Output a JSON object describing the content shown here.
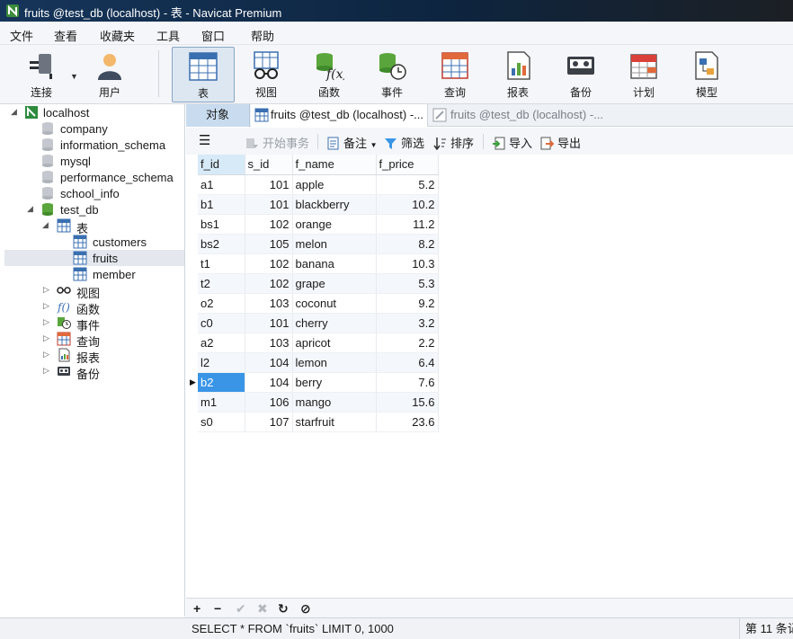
{
  "window": {
    "title": "fruits @test_db (localhost) - 表 - Navicat Premium"
  },
  "menu": [
    "文件",
    "查看",
    "收藏夹",
    "工具",
    "窗口",
    "帮助"
  ],
  "toolbar": [
    {
      "label": "连接",
      "icon": "plug-icon"
    },
    {
      "label": "用户",
      "icon": "user-icon"
    },
    {
      "label": "表",
      "icon": "table-icon"
    },
    {
      "label": "视图",
      "icon": "view-glasses-icon"
    },
    {
      "label": "函数",
      "icon": "function-icon"
    },
    {
      "label": "事件",
      "icon": "event-clock-icon"
    },
    {
      "label": "查询",
      "icon": "query-icon"
    },
    {
      "label": "报表",
      "icon": "report-icon"
    },
    {
      "label": "备份",
      "icon": "backup-tape-icon"
    },
    {
      "label": "计划",
      "icon": "calendar-icon"
    },
    {
      "label": "模型",
      "icon": "model-icon"
    }
  ],
  "tree": {
    "connection": "localhost",
    "databases": [
      "company",
      "information_schema",
      "mysql",
      "performance_schema",
      "school_info",
      "test_db"
    ],
    "tables_folder": "表",
    "tables": [
      "customers",
      "fruits",
      "member"
    ],
    "other_folders": [
      "视图",
      "函数",
      "事件",
      "查询",
      "报表",
      "备份"
    ]
  },
  "tabs": {
    "objects": "对象",
    "tab1": "fruits @test_db (localhost) -...",
    "tab2": "fruits @test_db (localhost) -..."
  },
  "gridtools": {
    "begin_tx": "开始事务",
    "memo": "备注",
    "filter": "筛选",
    "sort": "排序",
    "import": "导入",
    "export": "导出"
  },
  "grid": {
    "columns": [
      "f_id",
      "s_id",
      "f_name",
      "f_price"
    ],
    "rows": [
      [
        "a1",
        "101",
        "apple",
        "5.2"
      ],
      [
        "b1",
        "101",
        "blackberry",
        "10.2"
      ],
      [
        "bs1",
        "102",
        "orange",
        "11.2"
      ],
      [
        "bs2",
        "105",
        "melon",
        "8.2"
      ],
      [
        "t1",
        "102",
        "banana",
        "10.3"
      ],
      [
        "t2",
        "102",
        "grape",
        "5.3"
      ],
      [
        "o2",
        "103",
        "coconut",
        "9.2"
      ],
      [
        "c0",
        "101",
        "cherry",
        "3.2"
      ],
      [
        "a2",
        "103",
        "apricot",
        "2.2"
      ],
      [
        "l2",
        "104",
        "lemon",
        "6.4"
      ],
      [
        "b2",
        "104",
        "berry",
        "7.6"
      ],
      [
        "m1",
        "106",
        "mango",
        "15.6"
      ],
      [
        "s0",
        "107",
        "starfruit",
        "23.6"
      ]
    ],
    "selected_row": 10
  },
  "recordbar": [
    "+",
    "−",
    "✔",
    "✖",
    "↻",
    "⊘"
  ],
  "status": {
    "sql": "SELECT * FROM `fruits` LIMIT 0, 1000",
    "record": "第 11 条记"
  },
  "colors": {
    "selection": "#3a95e6",
    "titlebar": "#16355a",
    "active_tab": "#c9dcef"
  }
}
